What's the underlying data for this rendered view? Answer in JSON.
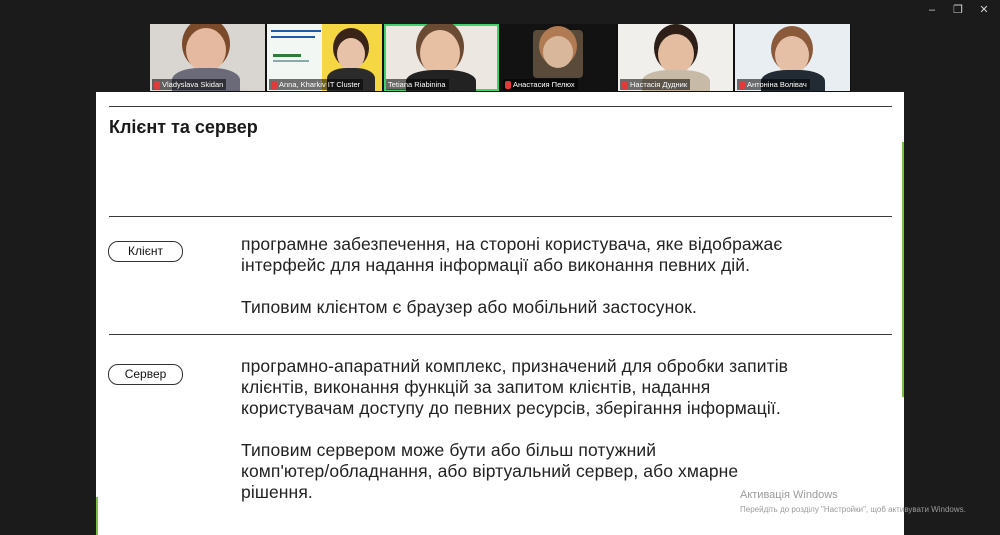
{
  "window_controls": {
    "minimize": "–",
    "restore": "❐",
    "close": "✕"
  },
  "participants": [
    {
      "name": "Vladyslava Skidan",
      "muted": true,
      "bg": "#d9d6d2",
      "skin": "#e4b9a0",
      "hair": "#7a4a2a",
      "shirt": "#6a6a78"
    },
    {
      "name": "Anna, Kharkiv IT Cluster",
      "muted": true,
      "bg": "#ffffff",
      "skin": "#e8c2a8",
      "hair": "#3a2418",
      "shirt": "#2b2b2b"
    },
    {
      "name": "Tetiana Riabinina",
      "muted": false,
      "bg": "#ece7e1",
      "skin": "#e7bfa3",
      "hair": "#6b4a33",
      "shirt": "#222222"
    },
    {
      "name": "Анастасия Пелюх",
      "muted": true,
      "bg": "#121212",
      "skin": "#d9b79b",
      "hair": "#b07a52",
      "shirt": "#2a2a2a"
    },
    {
      "name": "Настасія Дудник",
      "muted": true,
      "bg": "#f1efec",
      "skin": "#e4bda0",
      "hair": "#2d1f18",
      "shirt": "#c7bba7"
    },
    {
      "name": "Антоніна Волівач",
      "muted": true,
      "bg": "#e9eef2",
      "skin": "#e6c0a6",
      "hair": "#8a5a3a",
      "shirt": "#222a33"
    }
  ],
  "slide": {
    "title": "Клієнт та сервер",
    "client": {
      "label": "Клієнт",
      "lines": [
        "програмне забезпечення, на стороні користувача, яке відображає",
        "інтерфейс для надання інформації або виконання певних дій."
      ],
      "example": "Типовим клієнтом є браузер або мобільний застосунок."
    },
    "server": {
      "label": "Сервер",
      "lines": [
        "програмно-апаратний комплекс, призначений для обробки запитів",
        "клієнтів, виконання функцій за запитом клієнтів, надання",
        "користувачам доступу до певних ресурсів, зберігання інформації."
      ],
      "example_lines": [
        "Типовим сервером може бути або більш потужний",
        "комп'ютер/обладнання, або віртуальний сервер, або хмарне",
        "рішення."
      ]
    }
  },
  "watermark": {
    "line1": "Активація Windows",
    "line2": "Перейдіть до розділу \"Настройки\", щоб активувати Windows."
  },
  "colors": {
    "accent_green": "#7bc043",
    "active_speaker": "#3fd26b",
    "muted_mic": "#e23a3a"
  }
}
